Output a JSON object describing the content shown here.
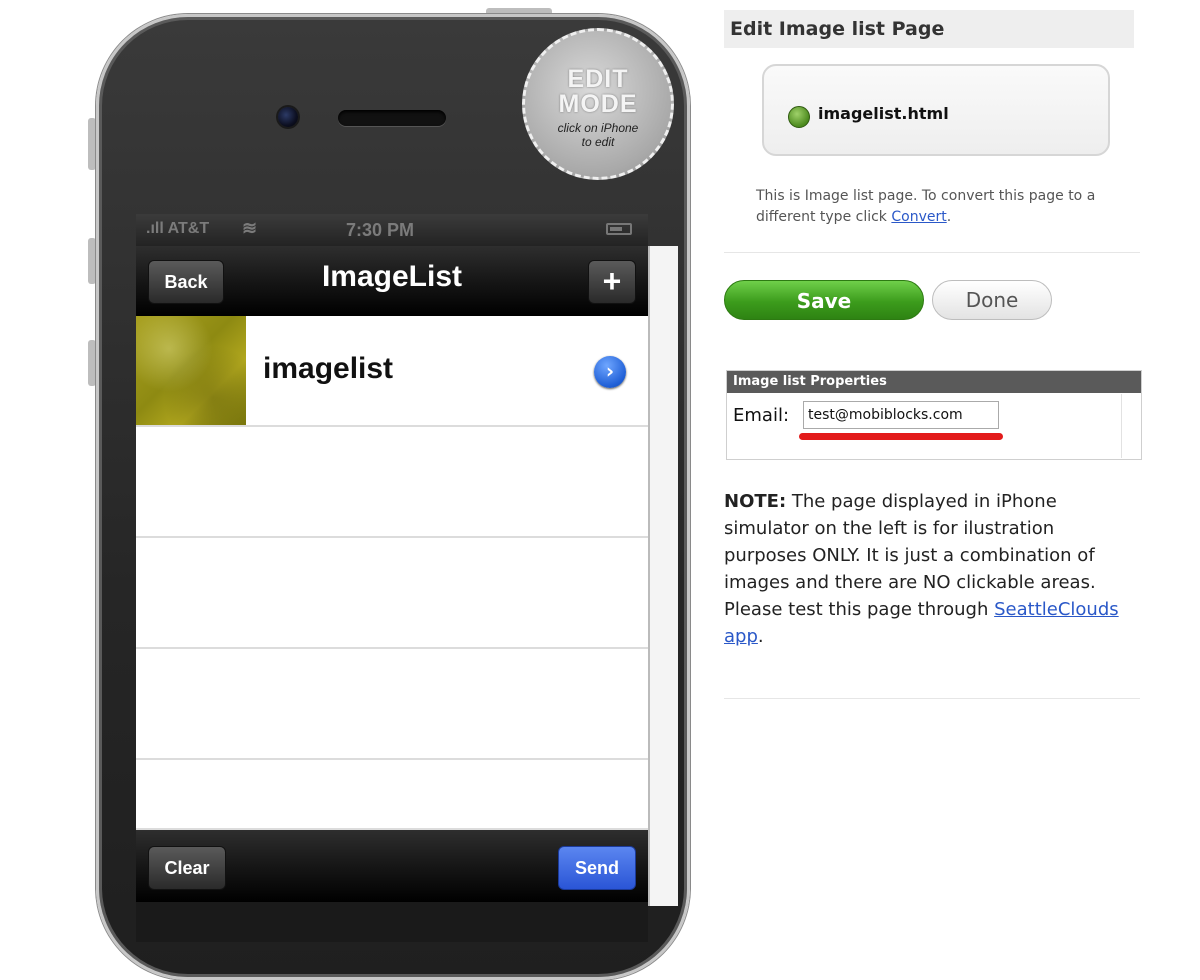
{
  "phone": {
    "edit_badge": {
      "line1": "EDIT",
      "line2": "MODE",
      "line3": "click on iPhone",
      "line4": "to edit"
    },
    "status_bar": {
      "carrier": "AT&T",
      "time": "7:30 PM"
    },
    "nav_bar": {
      "back_label": "Back",
      "title": "ImageList",
      "add_label": "+"
    },
    "list": [
      {
        "label": "imagelist"
      }
    ],
    "toolbar": {
      "clear_label": "Clear",
      "send_label": "Send"
    }
  },
  "panel": {
    "title": "Edit Image list Page",
    "file_name": "imagelist.html",
    "description_prefix": "This is Image list page. To convert this page to a different type click ",
    "convert_link": "Convert",
    "description_suffix": ".",
    "save_label": "Save",
    "done_label": "Done",
    "properties": {
      "header": "Image list Properties",
      "email_label": "Email:",
      "email_value": "test@mobiblocks.com"
    },
    "note": {
      "label": "NOTE:",
      "text": " The page displayed in iPhone simulator on the left is for ilustration purposes ONLY. It is just a combination of images and there are NO clickable areas. Please test this page through ",
      "link": "SeattleClouds app",
      "suffix": "."
    }
  },
  "colors": {
    "save_green": "#3c9c1c",
    "send_blue": "#2a55d6",
    "underline_red": "#e31b1b",
    "link_blue": "#2a58c8"
  }
}
